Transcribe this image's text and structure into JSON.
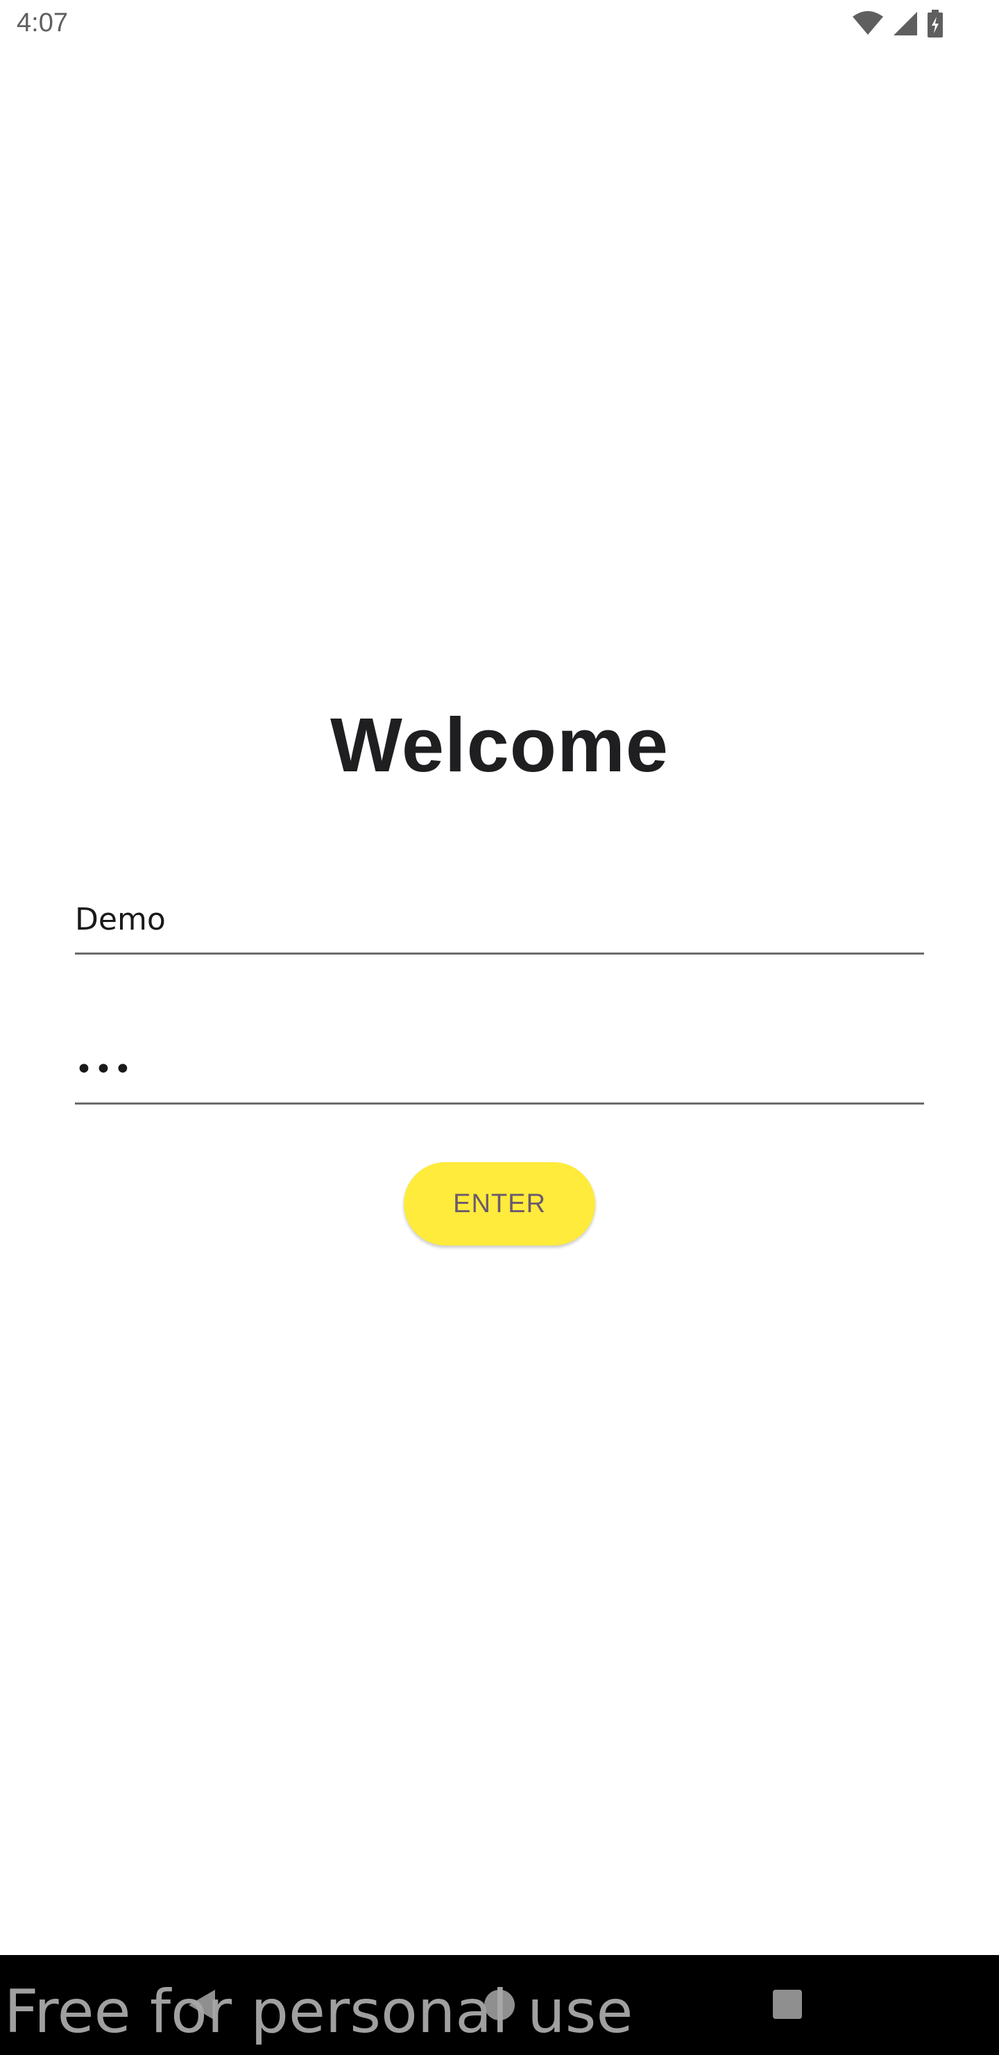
{
  "status_bar": {
    "time": "4:07",
    "icons": [
      "wifi-icon",
      "cell-signal-icon",
      "battery-charging-icon"
    ]
  },
  "login": {
    "title": "Welcome",
    "username_value": "Demo",
    "password_value": "•••",
    "enter_label": "ENTER",
    "accent_color": "#ffeb3b"
  },
  "nav_bar": {
    "buttons": [
      "back-icon",
      "home-icon",
      "recents-icon"
    ]
  },
  "watermark": "Free for personal use"
}
